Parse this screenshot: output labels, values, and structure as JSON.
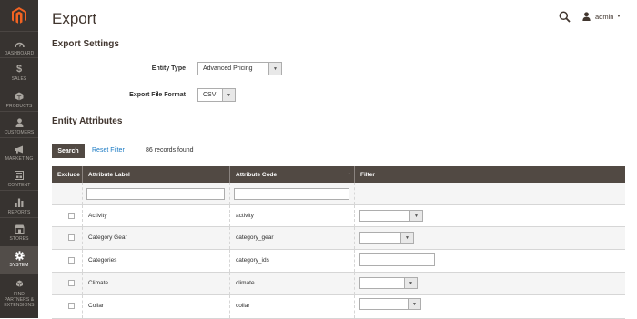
{
  "sidebar": {
    "logo": "magento-logo",
    "items": [
      {
        "label": "DASHBOARD",
        "icon": "dashboard-icon"
      },
      {
        "label": "SALES",
        "icon": "dollar-icon"
      },
      {
        "label": "PRODUCTS",
        "icon": "cube-icon"
      },
      {
        "label": "CUSTOMERS",
        "icon": "person-icon"
      },
      {
        "label": "MARKETING",
        "icon": "megaphone-icon"
      },
      {
        "label": "CONTENT",
        "icon": "layout-icon"
      },
      {
        "label": "REPORTS",
        "icon": "bar-chart-icon"
      },
      {
        "label": "STORES",
        "icon": "store-icon"
      },
      {
        "label": "SYSTEM",
        "icon": "gear-icon"
      },
      {
        "label": "FIND PARTNERS & EXTENSIONS",
        "icon": "boxes-icon"
      }
    ]
  },
  "header": {
    "title": "Export",
    "user": "admin"
  },
  "export_settings": {
    "title": "Export Settings",
    "entity_type_label": "Entity Type",
    "entity_type_value": "Advanced Pricing",
    "file_format_label": "Export File Format",
    "file_format_value": "CSV"
  },
  "entity_attributes": {
    "title": "Entity Attributes",
    "search_label": "Search",
    "reset_label": "Reset Filter",
    "records_found": "86 records found",
    "columns": [
      "Exclude",
      "Attribute Label",
      "Attribute Code",
      "Filter"
    ],
    "sort_indicator": "↓",
    "rows": [
      {
        "label": "Activity",
        "code": "activity",
        "filter": "select"
      },
      {
        "label": "Category Gear",
        "code": "category_gear",
        "filter": "select-short"
      },
      {
        "label": "Categories",
        "code": "category_ids",
        "filter": "text"
      },
      {
        "label": "Climate",
        "code": "climate",
        "filter": "select-short"
      },
      {
        "label": "Collar",
        "code": "collar",
        "filter": "select"
      }
    ]
  },
  "colors": {
    "sidebar_bg": "#373330",
    "header_bg": "#514943",
    "link": "#1979c3",
    "logo": "#f26322"
  }
}
